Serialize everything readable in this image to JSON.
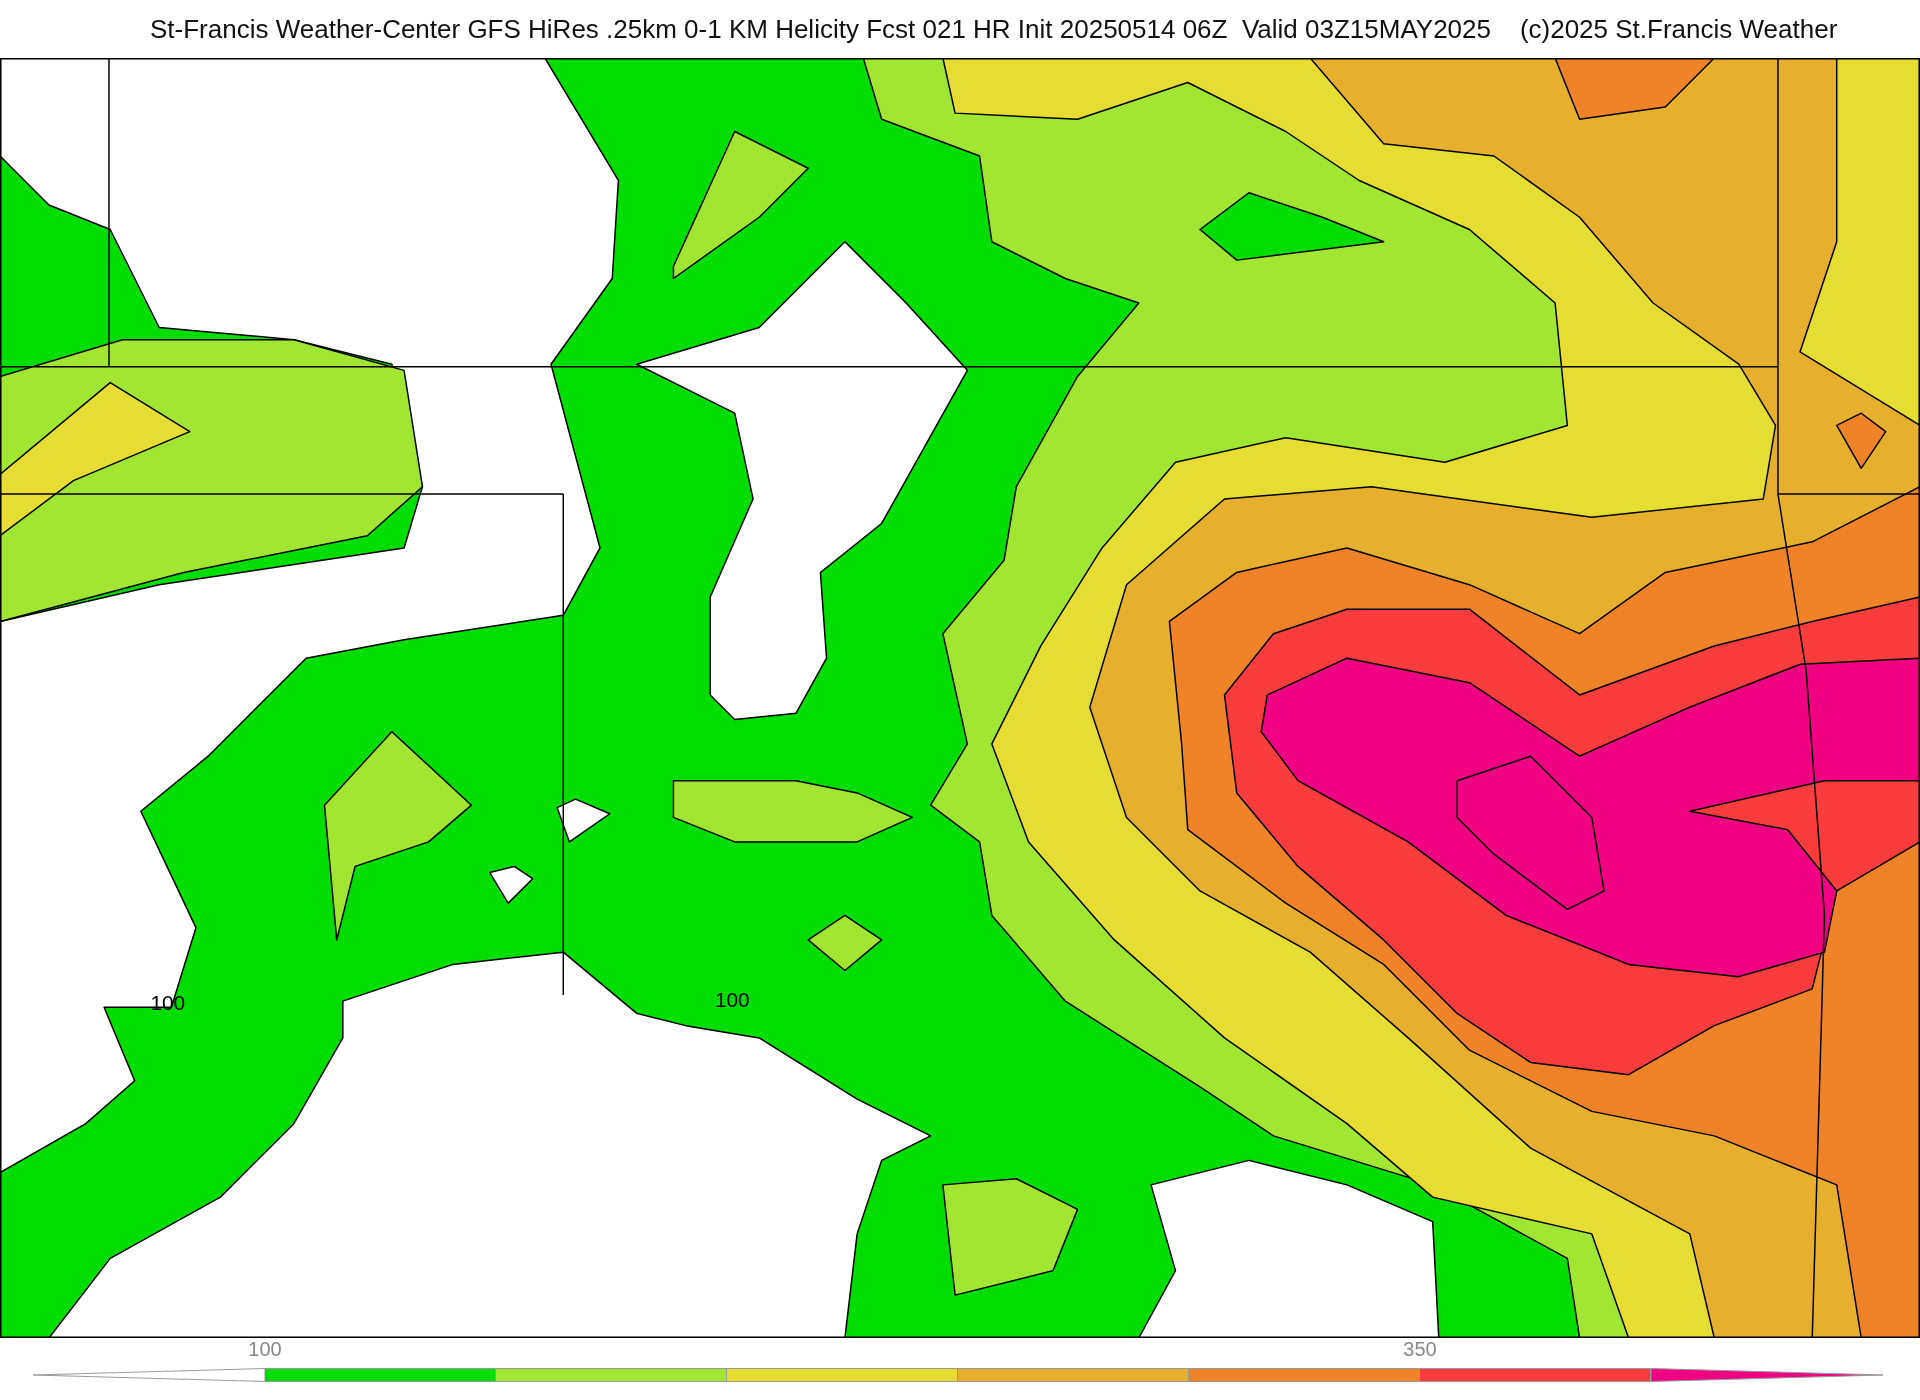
{
  "title": "St-Francis Weather-Center GFS HiRes .25km 0-1 KM Helicity Fcst 021 HR Init 20250514 06Z  Valid 03Z15MAY2025    (c)2025 St.Francis Weather",
  "map": {
    "contour_labels": [
      "100",
      "100"
    ]
  },
  "colorbar": {
    "bins": [
      {
        "kind": "arrow-left",
        "color": "#ffffff"
      },
      {
        "kind": "bin",
        "color": "#00dd00",
        "tick": "100"
      },
      {
        "kind": "bin",
        "color": "#a0e632"
      },
      {
        "kind": "bin",
        "color": "#e6dc32"
      },
      {
        "kind": "bin",
        "color": "#e6af2d"
      },
      {
        "kind": "bin",
        "color": "#f08228"
      },
      {
        "kind": "bin",
        "color": "#fa3c3c",
        "tick": "350"
      },
      {
        "kind": "arrow-right",
        "color": "#f00082"
      }
    ]
  }
}
